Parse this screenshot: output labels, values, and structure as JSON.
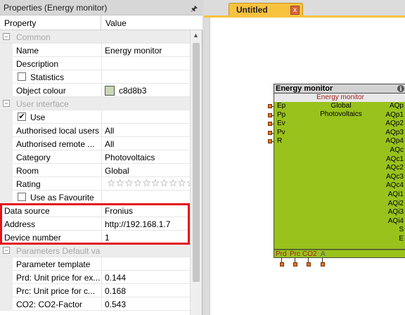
{
  "properties_panel": {
    "title": "Properties (Energy monitor)",
    "pin_glyph": "🖈",
    "columns": {
      "property": "Property",
      "value": "Value"
    }
  },
  "groups": {
    "common": "Common",
    "user_interface": "User interface",
    "parameters": "Parameters Default value"
  },
  "rows": {
    "name": {
      "label": "Name",
      "value": "Energy monitor"
    },
    "description": {
      "label": "Description",
      "value": ""
    },
    "statistics": {
      "label": "Statistics",
      "checked": false
    },
    "object_colour": {
      "label": "Object colour",
      "value": "c8d8b3",
      "color": "#c8d8b3"
    },
    "use": {
      "label": "Use",
      "checked": true,
      "mark": "✔"
    },
    "authorised_local": {
      "label": "Authorised local users",
      "value": "All"
    },
    "authorised_remote": {
      "label": "Authorised remote ...",
      "value": "All"
    },
    "category": {
      "label": "Category",
      "value": "Photovoltaics"
    },
    "room": {
      "label": "Room",
      "value": "Global"
    },
    "rating": {
      "label": "Rating",
      "stars": "☆☆☆☆☆☆☆☆☆☆"
    },
    "use_as_favourite": {
      "label": "Use as Favourite",
      "checked": false
    },
    "data_source": {
      "label": "Data source",
      "value": "Fronius"
    },
    "address": {
      "label": "Address",
      "value": "http://192.168.1.7"
    },
    "device_number": {
      "label": "Device number",
      "value": "1"
    },
    "parameter_template": {
      "label": "Parameter template",
      "value": ""
    },
    "prd": {
      "label": "Prd: Unit price for ex...",
      "value": "0.144"
    },
    "prc": {
      "label": "Prc: Unit price for c...",
      "value": "0.168"
    },
    "co2": {
      "label": "CO2: CO2-Factor",
      "value": "0.543"
    }
  },
  "document": {
    "tab_label": "Untitled",
    "tab_close": "x"
  },
  "block": {
    "title": "Energy monitor",
    "info": "i",
    "subtitle": "Energy monitor",
    "room": "Global",
    "category": "Photovoltaics",
    "inputs": [
      "Ep",
      "Pp",
      "Ev",
      "Pv",
      "R"
    ],
    "outputs": [
      "AQp",
      "AQp1",
      "AQp2",
      "AQp3",
      "AQp4",
      "AQc",
      "AQc1",
      "AQc2",
      "AQc3",
      "AQc4",
      "AQi1",
      "AQi2",
      "AQi3",
      "AQi4",
      "S",
      "E"
    ],
    "footer_params": [
      "Prd",
      "Prc",
      "CO2"
    ],
    "footer_extra": "A"
  },
  "colors": {
    "block_body": "#99c21c",
    "input_port": "#ee7318",
    "output_port": "#34c71b",
    "highlight": "#e3141a",
    "tab": "#f7c33f"
  }
}
